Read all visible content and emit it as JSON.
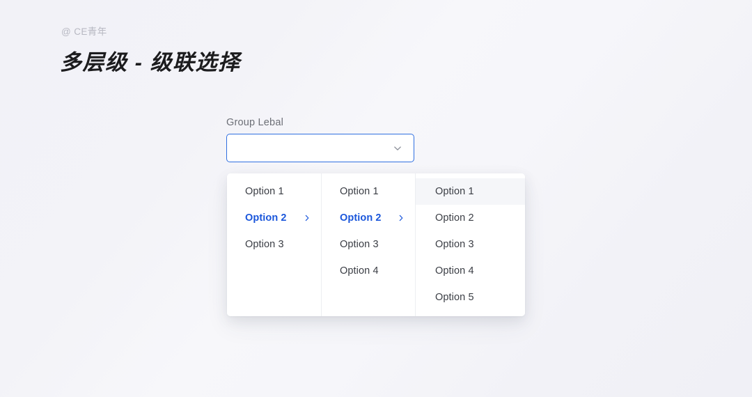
{
  "watermark": "@ CE青年",
  "title": "多层级 - 级联选择",
  "colors": {
    "accent_blue": "#1a56db",
    "field_border_blue": "#2f6fe0",
    "background": "#f3f3f8",
    "panel_white": "#ffffff",
    "hover_gray": "#f5f6f9",
    "label_gray": "#6c6f76",
    "item_text": "#3a3d44",
    "watermark_gray": "#b7b8c2",
    "divider": "#eceef1"
  },
  "field": {
    "label": "Group Lebal",
    "value": "",
    "placeholder": "",
    "dropdown_icon": "chevron-down-icon"
  },
  "cascader": {
    "submenu_icon": "chevron-right-icon",
    "columns": [
      {
        "name": "level-1",
        "items": [
          {
            "label": "Option 1",
            "state": "default",
            "has_children": false
          },
          {
            "label": "Option 2",
            "state": "active",
            "has_children": true
          },
          {
            "label": "Option 3",
            "state": "default",
            "has_children": false
          }
        ]
      },
      {
        "name": "level-2",
        "items": [
          {
            "label": "Option 1",
            "state": "default",
            "has_children": false
          },
          {
            "label": "Option 2",
            "state": "active",
            "has_children": true
          },
          {
            "label": "Option 3",
            "state": "default",
            "has_children": false
          },
          {
            "label": "Option 4",
            "state": "default",
            "has_children": false
          }
        ]
      },
      {
        "name": "level-3",
        "items": [
          {
            "label": "Option 1",
            "state": "hover",
            "has_children": false
          },
          {
            "label": "Option 2",
            "state": "default",
            "has_children": false
          },
          {
            "label": "Option 3",
            "state": "default",
            "has_children": false
          },
          {
            "label": "Option 4",
            "state": "default",
            "has_children": false
          },
          {
            "label": "Option 5",
            "state": "default",
            "has_children": false
          }
        ]
      }
    ]
  }
}
